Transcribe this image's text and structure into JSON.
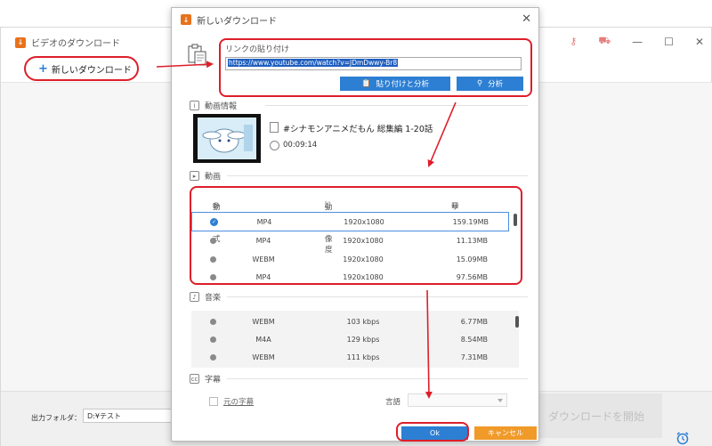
{
  "main_window": {
    "title": "ビデオのダウンロード",
    "new_download_label": "新しいダウンロード",
    "output_folder_label": "出力フォルダ：",
    "output_folder_value": "D:¥テスト",
    "start_download_label": "ダウンロードを開始"
  },
  "dialog": {
    "title": "新しいダウンロード",
    "paste_link_label": "リンクの貼り付け",
    "url_value": "https://www.youtube.com/watch?v=JDmDwwy-Br8",
    "paste_analyze_label": "貼り付けと分析",
    "analyze_label": "分析",
    "video_info_label": "動画情報",
    "video_title": "#シナモンアニメだもん 総集編 1-20話",
    "video_duration": "00:09:14",
    "video_section_label": "動画",
    "video_table": {
      "headers": [
        "動画形式",
        "動画解像度",
        "サイズ"
      ],
      "rows": [
        {
          "format": "MP4",
          "resolution": "1920x1080",
          "size": "159.19MB",
          "selected": true
        },
        {
          "format": "MP4",
          "resolution": "1920x1080",
          "size": "11.13MB",
          "selected": false
        },
        {
          "format": "WEBM",
          "resolution": "1920x1080",
          "size": "15.09MB",
          "selected": false
        },
        {
          "format": "MP4",
          "resolution": "1920x1080",
          "size": "97.56MB",
          "selected": false
        }
      ]
    },
    "audio_section_label": "音楽",
    "audio_table": {
      "rows": [
        {
          "format": "WEBM",
          "bitrate": "103 kbps",
          "size": "6.77MB"
        },
        {
          "format": "M4A",
          "bitrate": "129 kbps",
          "size": "8.54MB"
        },
        {
          "format": "WEBM",
          "bitrate": "111 kbps",
          "size": "7.31MB"
        }
      ]
    },
    "subtitle_section_label": "字幕",
    "original_subtitles_label": "元の字幕",
    "language_label": "言語",
    "ok_label": "Ok",
    "cancel_label": "キャンセル"
  },
  "colors": {
    "accent_blue": "#2d7fd3",
    "cancel_orange": "#f09a2a",
    "annotation_red": "#dd1f2a"
  }
}
